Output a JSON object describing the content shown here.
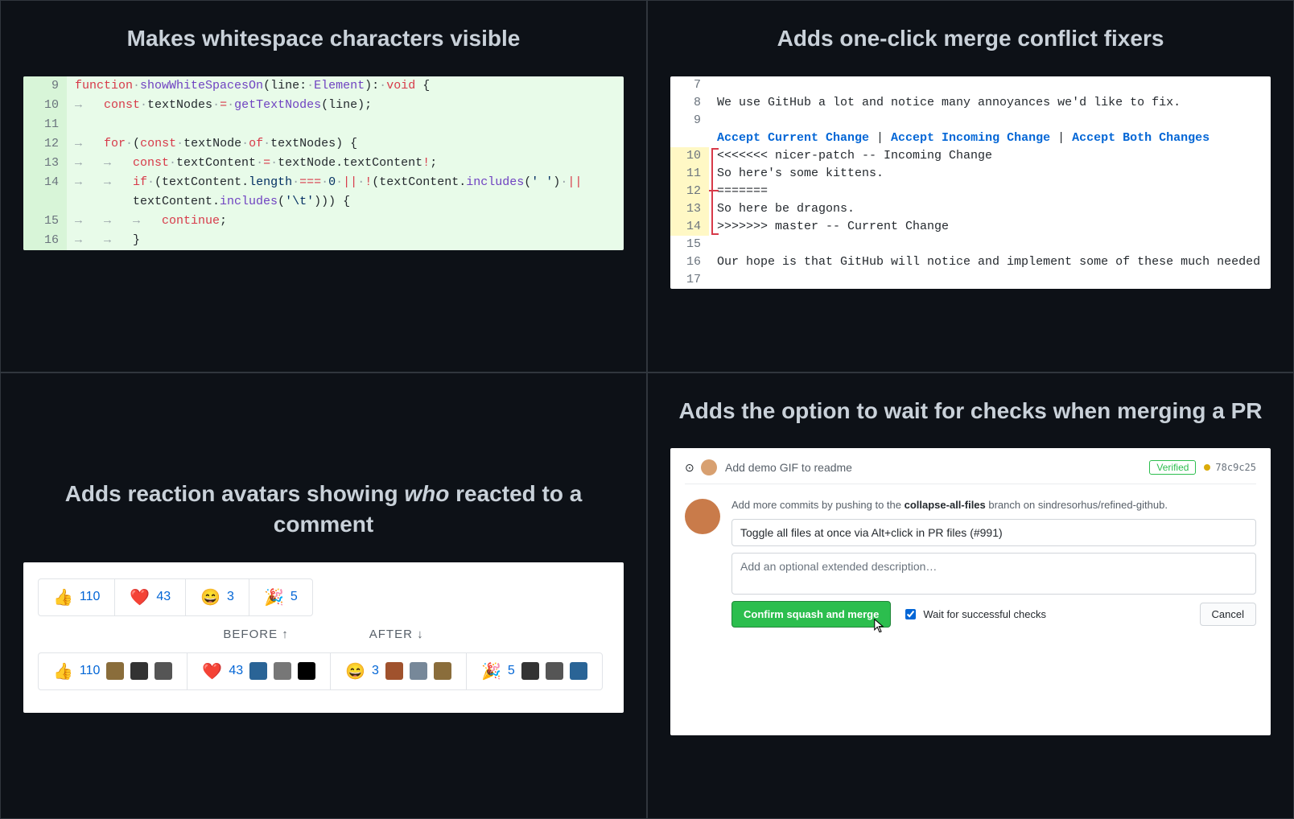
{
  "cells": {
    "whitespace": {
      "title": "Makes whitespace characters visible",
      "code": {
        "lines": [
          {
            "n": 9,
            "tokens": [
              [
                "k-red",
                "function"
              ],
              [
                "ws",
                "·"
              ],
              [
                "k-purple",
                "showWhiteSpacesOn"
              ],
              [
                "",
                "("
              ],
              [
                "k-name",
                "line"
              ],
              [
                "",
                ":"
              ],
              [
                "ws",
                "·"
              ],
              [
                "k-purple",
                "Element"
              ],
              [
                "",
                ")"
              ],
              [
                "",
                ":"
              ],
              [
                "ws",
                "·"
              ],
              [
                "k-red",
                "void"
              ],
              [
                "",
                " {"
              ]
            ]
          },
          {
            "n": 10,
            "tokens": [
              [
                "ws",
                "→   "
              ],
              [
                "k-red",
                "const"
              ],
              [
                "ws",
                "·"
              ],
              [
                "k-name",
                "textNodes"
              ],
              [
                "ws",
                "·"
              ],
              [
                "k-red",
                "="
              ],
              [
                "ws",
                "·"
              ],
              [
                "k-purple",
                "getTextNodes"
              ],
              [
                "",
                "(line);"
              ]
            ]
          },
          {
            "n": 11,
            "tokens": [
              [
                "",
                ""
              ]
            ]
          },
          {
            "n": 12,
            "tokens": [
              [
                "ws",
                "→   "
              ],
              [
                "k-red",
                "for"
              ],
              [
                "ws",
                "·"
              ],
              [
                "",
                "("
              ],
              [
                "k-red",
                "const"
              ],
              [
                "ws",
                "·"
              ],
              [
                "k-name",
                "textNode"
              ],
              [
                "ws",
                "·"
              ],
              [
                "k-red",
                "of"
              ],
              [
                "ws",
                "·"
              ],
              [
                "k-name",
                "textNodes"
              ],
              [
                "",
                ") {"
              ]
            ]
          },
          {
            "n": 13,
            "tokens": [
              [
                "ws",
                "→   →   "
              ],
              [
                "k-red",
                "const"
              ],
              [
                "ws",
                "·"
              ],
              [
                "k-name",
                "textContent"
              ],
              [
                "ws",
                "·"
              ],
              [
                "k-red",
                "="
              ],
              [
                "ws",
                "·"
              ],
              [
                "k-name",
                "textNode"
              ],
              [
                "",
                ".textContent"
              ],
              [
                "k-red",
                "!"
              ],
              [
                "",
                ";"
              ]
            ]
          },
          {
            "n": 14,
            "tokens": [
              [
                "ws",
                "→   →   "
              ],
              [
                "k-red",
                "if"
              ],
              [
                "ws",
                "·"
              ],
              [
                "",
                "(textContent."
              ],
              [
                "k-blue",
                "length"
              ],
              [
                "ws",
                "·"
              ],
              [
                "k-red",
                "==="
              ],
              [
                "ws",
                "·"
              ],
              [
                "k-blue",
                "0"
              ],
              [
                "ws",
                "·"
              ],
              [
                "k-red",
                "||"
              ],
              [
                "ws",
                "·"
              ],
              [
                "k-red",
                "!"
              ],
              [
                "",
                "(textContent."
              ],
              [
                "k-purple",
                "includes"
              ],
              [
                "",
                "("
              ],
              [
                "k-blue",
                "' '"
              ],
              [
                "",
                ")"
              ],
              [
                "ws",
                "·"
              ],
              [
                "k-red",
                "||"
              ]
            ]
          },
          {
            "n": "",
            "tokens": [
              [
                "",
                "        textContent."
              ],
              [
                "k-purple",
                "includes"
              ],
              [
                "",
                "("
              ],
              [
                "k-blue",
                "'\\t'"
              ],
              [
                "",
                "))) {"
              ]
            ]
          },
          {
            "n": 15,
            "tokens": [
              [
                "ws",
                "→   →   →   "
              ],
              [
                "k-red",
                "continue"
              ],
              [
                "",
                ";"
              ]
            ]
          },
          {
            "n": 16,
            "tokens": [
              [
                "ws",
                "→   →   "
              ],
              [
                "",
                "}"
              ]
            ]
          }
        ]
      }
    },
    "merge_conflict": {
      "title": "Adds one-click merge conflict fixers",
      "links": {
        "accept_current": "Accept Current Change",
        "accept_incoming": "Accept Incoming Change",
        "accept_both": "Accept Both Changes",
        "sep": " | "
      },
      "lines": [
        {
          "n": 7,
          "hl": false,
          "text": ""
        },
        {
          "n": 8,
          "hl": false,
          "text": "We use GitHub a lot and notice many annoyances we'd like to fix."
        },
        {
          "n": 9,
          "hl": false,
          "text": ""
        },
        {
          "n": "",
          "hl": false,
          "text": "__LINKS__"
        },
        {
          "n": 10,
          "hl": true,
          "text": "<<<<<<< nicer-patch -- Incoming Change"
        },
        {
          "n": 11,
          "hl": true,
          "text": "So here's some kittens."
        },
        {
          "n": 12,
          "hl": true,
          "text": "======="
        },
        {
          "n": 13,
          "hl": true,
          "text": "So here be dragons."
        },
        {
          "n": 14,
          "hl": true,
          "text": ">>>>>>> master -- Current Change"
        },
        {
          "n": 15,
          "hl": false,
          "text": ""
        },
        {
          "n": 16,
          "hl": false,
          "text": "Our hope is that GitHub will notice and implement some of these much needed"
        },
        {
          "n": 17,
          "hl": false,
          "text": ""
        }
      ]
    },
    "reactions": {
      "title_pre": "Adds reaction avatars showing ",
      "title_em": "who",
      "title_post": " reacted to a comment",
      "before_label": "BEFORE ↑",
      "after_label": "AFTER ↓",
      "before": [
        {
          "emoji": "👍",
          "count": 110
        },
        {
          "emoji": "❤️",
          "count": 43
        },
        {
          "emoji": "😄",
          "count": 3
        },
        {
          "emoji": "🎉",
          "count": 5
        }
      ],
      "after": [
        {
          "emoji": "👍",
          "count": 110,
          "avatars": 3
        },
        {
          "emoji": "❤️",
          "count": 43,
          "avatars": 3
        },
        {
          "emoji": "😄",
          "count": 3,
          "avatars": 3
        },
        {
          "emoji": "🎉",
          "count": 5,
          "avatars": 3
        }
      ]
    },
    "wait_checks": {
      "title": "Adds the option to wait for checks when merging a PR",
      "commit_msg": "Add demo GIF to readme",
      "verified": "Verified",
      "sha": "78c9c25",
      "note_pre": "Add more commits by pushing to the ",
      "branch": "collapse-all-files",
      "note_mid": " branch on ",
      "repo": "sindresorhus/refined-github",
      "note_post": ".",
      "title_input": "Toggle all files at once via Alt+click in PR files (#991)",
      "desc_placeholder": "Add an optional extended description…",
      "confirm_btn": "Confirm squash and merge",
      "wait_label": "Wait for successful checks",
      "cancel_btn": "Cancel"
    }
  }
}
